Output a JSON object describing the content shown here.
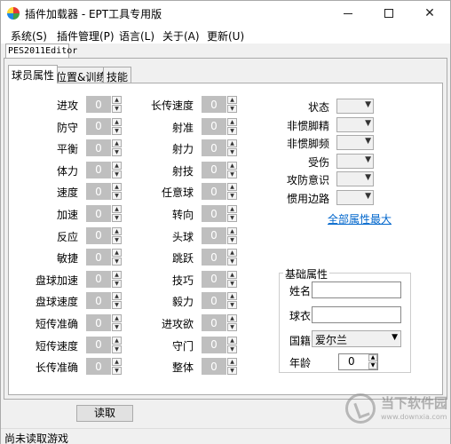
{
  "window": {
    "title": "插件加载器 - EPT工具专用版",
    "controls": {
      "minimize": "—",
      "maximize": "□",
      "close": "✕"
    }
  },
  "menu": [
    "系统(S)",
    "插件管理(P)",
    "语言(L)",
    "关于(A)",
    "更新(U)"
  ],
  "outer_tab": "PES2011Editor",
  "tabs": [
    "球员属性",
    "位置&训练",
    "技能"
  ],
  "left_stats": [
    {
      "label": "进攻",
      "value": "0"
    },
    {
      "label": "防守",
      "value": "0"
    },
    {
      "label": "平衡",
      "value": "0"
    },
    {
      "label": "体力",
      "value": "0"
    },
    {
      "label": "速度",
      "value": "0"
    },
    {
      "label": "加速",
      "value": "0"
    },
    {
      "label": "反应",
      "value": "0"
    },
    {
      "label": "敏捷",
      "value": "0"
    },
    {
      "label": "盘球加速",
      "value": "0"
    },
    {
      "label": "盘球速度",
      "value": "0"
    },
    {
      "label": "短传准确",
      "value": "0"
    },
    {
      "label": "短传速度",
      "value": "0"
    },
    {
      "label": "长传准确",
      "value": "0"
    }
  ],
  "mid_stats": [
    {
      "label": "长传速度",
      "value": "0"
    },
    {
      "label": "射准",
      "value": "0"
    },
    {
      "label": "射力",
      "value": "0"
    },
    {
      "label": "射技",
      "value": "0"
    },
    {
      "label": "任意球",
      "value": "0"
    },
    {
      "label": "转向",
      "value": "0"
    },
    {
      "label": "头球",
      "value": "0"
    },
    {
      "label": "跳跃",
      "value": "0"
    },
    {
      "label": "技巧",
      "value": "0"
    },
    {
      "label": "毅力",
      "value": "0"
    },
    {
      "label": "进攻欲",
      "value": "0"
    },
    {
      "label": "守门",
      "value": "0"
    },
    {
      "label": "整体",
      "value": "0"
    }
  ],
  "right_dropdowns": [
    "状态",
    "非惯脚精",
    "非惯脚频",
    "受伤",
    "攻防意识",
    "惯用边路"
  ],
  "link_all_max": "全部属性最大",
  "basic": {
    "title": "基础属性",
    "name_label": "姓名",
    "jersey_label": "球衣",
    "nationality_label": "国籍",
    "nationality_value": "爱尔兰",
    "age_label": "年龄",
    "age_value": "0"
  },
  "read_button": "读取",
  "status": "尚未读取游戏",
  "watermark": {
    "line1": "当下软件园",
    "line2": "www.downxia.com"
  }
}
